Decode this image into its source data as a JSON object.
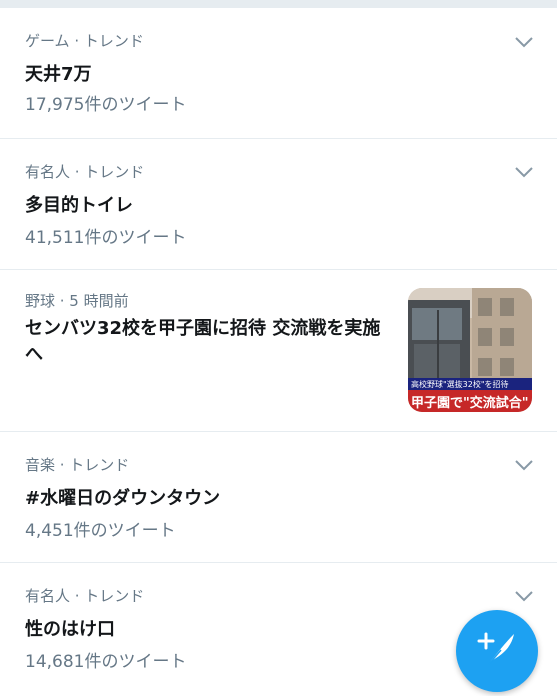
{
  "trends": [
    {
      "meta": "ゲーム · トレンド",
      "title": "天井7万",
      "count": "17,975件のツイート"
    },
    {
      "meta": "有名人 · トレンド",
      "title": "多目的トイレ",
      "count": "41,511件のツイート"
    }
  ],
  "news": {
    "meta": "野球 · 5 時間前",
    "title": "センバツ32校を甲子園に招待 交流戦を実施へ",
    "thumb_caption_top": "高校野球\"選抜32校\"を招待",
    "thumb_caption_main": "甲子園で\"交流試合\""
  },
  "trends2": [
    {
      "meta": "音楽 · トレンド",
      "title": "#水曜日のダウンタウン",
      "count": "4,451件のツイート"
    },
    {
      "meta": "有名人 · トレンド",
      "title": "性のはけ口",
      "count": "14,681件のツイート"
    }
  ],
  "colors": {
    "accent": "#1da1f2",
    "secondary_text": "#657786",
    "divider": "#e6ecf0"
  },
  "icons": {
    "more": "chevron-down-icon",
    "compose": "compose-tweet-icon"
  }
}
